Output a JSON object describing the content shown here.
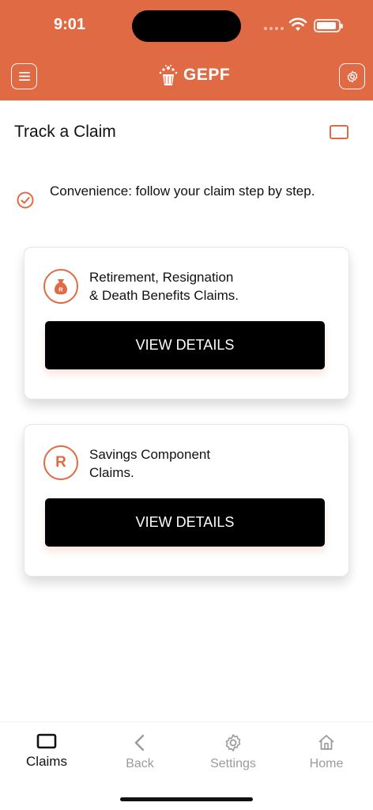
{
  "status_bar": {
    "time": "9:01"
  },
  "header": {
    "logo_text": "GEPF",
    "icons": {
      "menu": "hamburger-icon",
      "settings": "gear-icon",
      "logo": "gepf-logo-icon"
    },
    "color": "#E06A44"
  },
  "page": {
    "title": "Track a Claim",
    "info_text": "Convenience: follow your claim step by step."
  },
  "cards": [
    {
      "text_line1": "Retirement, Resignation",
      "text_line2": "& Death Benefits Claims.",
      "button_label": "VIEW DETAILS",
      "icon": "money-bag-icon"
    },
    {
      "text_line1": "Savings Component",
      "text_line2": "Claims.",
      "button_label": "VIEW DETAILS",
      "icon": "rand-icon",
      "icon_text": "R"
    }
  ],
  "tabbar": {
    "tabs": [
      {
        "label": "Claims",
        "icon": "claims-icon",
        "active": true
      },
      {
        "label": "Back",
        "icon": "chevron-left-icon",
        "active": false
      },
      {
        "label": "Settings",
        "icon": "gear-icon",
        "active": false
      },
      {
        "label": "Home",
        "icon": "home-icon",
        "active": false
      }
    ]
  },
  "colors": {
    "accent": "#E06A44",
    "button": "#000000",
    "inactive_tab": "#9b9b9b"
  }
}
